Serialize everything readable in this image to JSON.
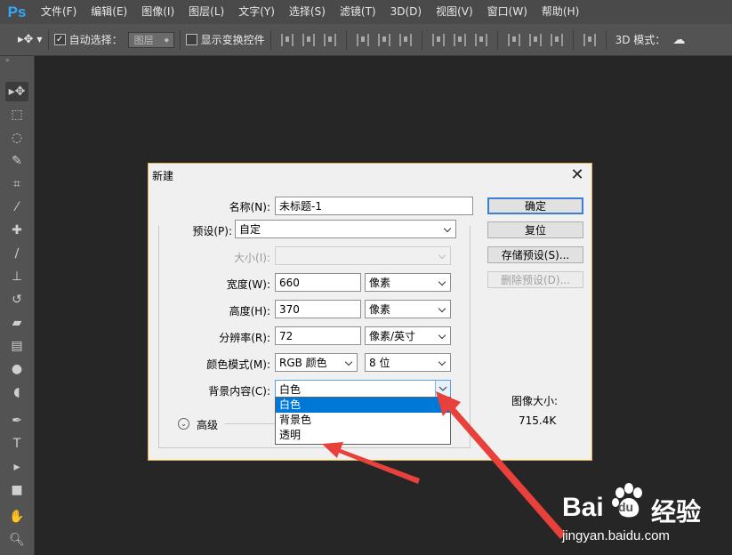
{
  "app": {
    "logo": "Ps"
  },
  "menu": [
    "文件(F)",
    "编辑(E)",
    "图像(I)",
    "图层(L)",
    "文字(Y)",
    "选择(S)",
    "滤镜(T)",
    "3D(D)",
    "视图(V)",
    "窗口(W)",
    "帮助(H)"
  ],
  "options": {
    "auto_select_label": "自动选择：",
    "auto_select_value": "图层",
    "show_transform_label": "显示变换控件",
    "mode_3d_label": "3D 模式："
  },
  "dialog": {
    "title": "新建",
    "name_label": "名称(N):",
    "name_value": "未标题-1",
    "preset_label": "预设(P):",
    "preset_value": "自定",
    "size_label": "大小(I):",
    "width_label": "宽度(W):",
    "width_value": "660",
    "width_unit": "像素",
    "height_label": "高度(H):",
    "height_value": "370",
    "height_unit": "像素",
    "resolution_label": "分辨率(R):",
    "resolution_value": "72",
    "resolution_unit": "像素/英寸",
    "color_mode_label": "颜色模式(M):",
    "color_mode_value": "RGB 颜色",
    "bit_depth_value": "8 位",
    "bg_label": "背景内容(C):",
    "bg_value": "白色",
    "bg_options": [
      "白色",
      "背景色",
      "透明"
    ],
    "advanced_label": "高级",
    "ok_button": "确定",
    "reset_button": "复位",
    "save_preset_button": "存储预设(S)...",
    "delete_preset_button": "删除预设(D)...",
    "image_size_label": "图像大小:",
    "image_size_value": "715.4K"
  },
  "watermark": {
    "brand": "Bai",
    "brand2": "du",
    "sub": "经验",
    "url": "jingyan.baidu.com"
  },
  "colors": {
    "annotation_red": "#e8413c",
    "selection_blue": "#0078d7",
    "ps_blue": "#31a8ff"
  }
}
